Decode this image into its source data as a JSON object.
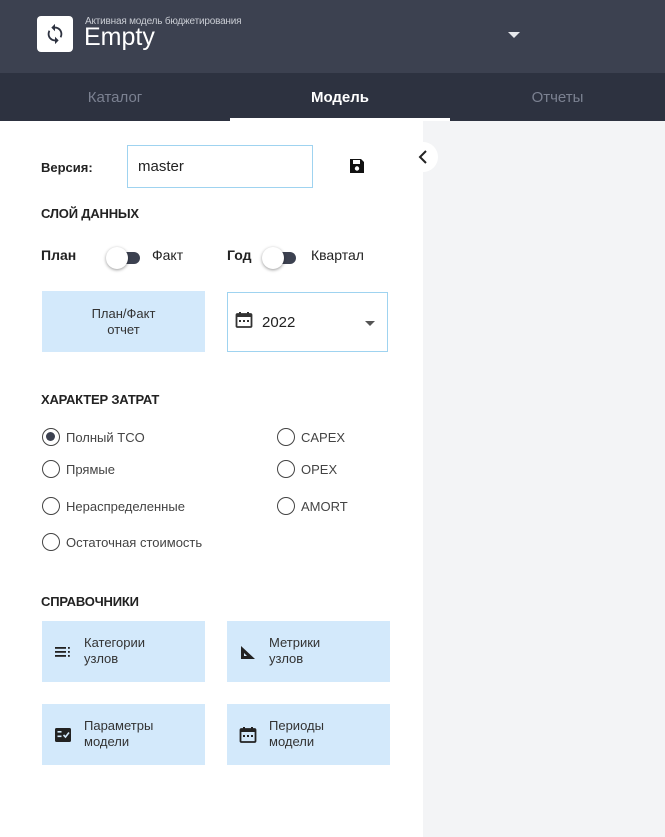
{
  "header": {
    "model_caption": "Активная модель бюджетирования",
    "model_name": "Empty"
  },
  "tabs": [
    {
      "label": "Каталог",
      "active": false
    },
    {
      "label": "Модель",
      "active": true
    },
    {
      "label": "Отчеты",
      "active": false
    }
  ],
  "version": {
    "label": "Версия:",
    "value": "master"
  },
  "data_layer": {
    "title": "СЛОЙ ДАННЫХ",
    "toggle1": {
      "left": "План",
      "right": "Факт"
    },
    "toggle2": {
      "left": "Год",
      "right": "Квартал"
    }
  },
  "report_button": "План/Факт\nотчет",
  "year_select": {
    "value": "2022"
  },
  "cost_nature": {
    "title": "ХАРАКТЕР ЗАТРАТ",
    "options": [
      {
        "label": "Полный TCO",
        "selected": true
      },
      {
        "label": "Прямые",
        "selected": false
      },
      {
        "label": "Нераспределенные",
        "selected": false
      },
      {
        "label": "Остаточная стоимость",
        "selected": false
      },
      {
        "label": "CAPEX",
        "selected": false
      },
      {
        "label": "OPEX",
        "selected": false
      },
      {
        "label": "AMORT",
        "selected": false
      }
    ]
  },
  "references": {
    "title": "СПРАВОЧНИКИ",
    "buttons": [
      {
        "label": "Категории\nузлов",
        "icon": "list-icon"
      },
      {
        "label": "Метрики\nузлов",
        "icon": "ruler-icon"
      },
      {
        "label": "Параметры\nмодели",
        "icon": "checklist-icon"
      },
      {
        "label": "Периоды\nмодели",
        "icon": "calendar-icon"
      }
    ]
  },
  "colors": {
    "header_bg": "#3c4150",
    "tabs_bg": "#2d3240",
    "button_bg": "#d3e9fb",
    "input_border": "#9fd3f0",
    "right_area_bg": "#f3f4f6"
  }
}
